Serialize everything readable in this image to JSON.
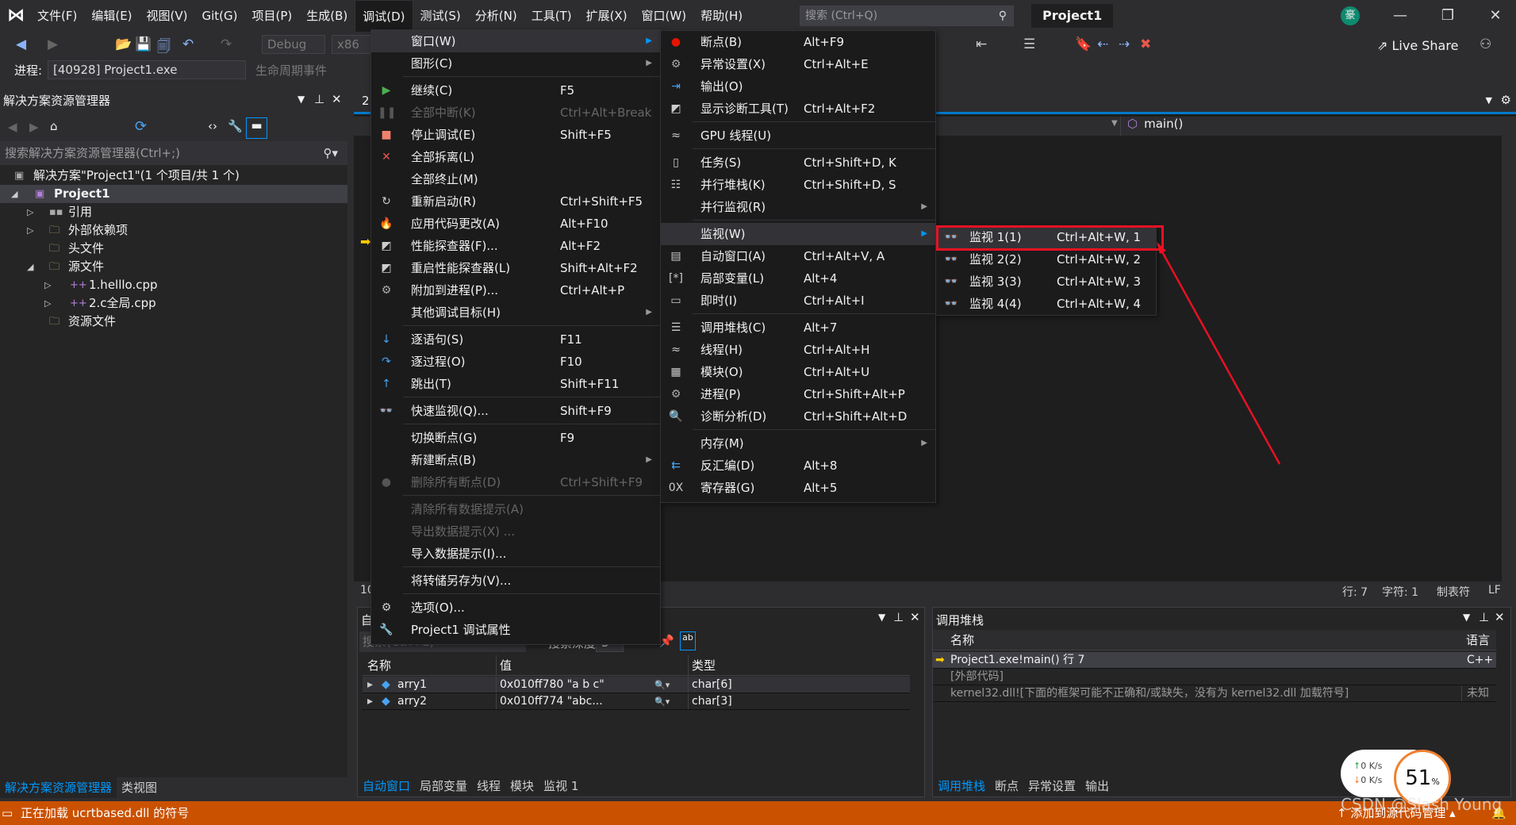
{
  "menubar": {
    "items": [
      "文件(F)",
      "编辑(E)",
      "视图(V)",
      "Git(G)",
      "项目(P)",
      "生成(B)",
      "调试(D)",
      "测试(S)",
      "分析(N)",
      "工具(T)",
      "扩展(X)",
      "窗口(W)",
      "帮助(H)"
    ],
    "active_index": 6,
    "search_placeholder": "搜索 (Ctrl+Q)",
    "project_title": "Project1",
    "avatar": "豪"
  },
  "toolbar": {
    "config": "Debug",
    "platform": "x86",
    "process_label": "进程:",
    "process_value": "[40928] Project1.exe",
    "lifecycle": "生命周期事件",
    "live_share": "Live Share"
  },
  "solution_explorer": {
    "title": "解决方案资源管理器",
    "search_placeholder": "搜索解决方案资源管理器(Ctrl+;)",
    "tree": [
      {
        "label": "解决方案\"Project1\"(1 个项目/共 1 个)",
        "level": 0,
        "twisty": "",
        "icon": "solution-icon"
      },
      {
        "label": "Project1",
        "level": 1,
        "twisty": "expanded",
        "icon": "cpp-project-icon",
        "bold": true,
        "selected": true
      },
      {
        "label": "引用",
        "level": 2,
        "twisty": "collapsed",
        "icon": "references-icon"
      },
      {
        "label": "外部依赖项",
        "level": 2,
        "twisty": "collapsed",
        "icon": "external-deps-icon"
      },
      {
        "label": "头文件",
        "level": 2,
        "twisty": "",
        "icon": "filter-folder-icon"
      },
      {
        "label": "源文件",
        "level": 2,
        "twisty": "expanded",
        "icon": "filter-folder-icon"
      },
      {
        "label": "1.helllo.cpp",
        "level": 3,
        "twisty": "collapsed",
        "icon": "cpp-file-icon"
      },
      {
        "label": "2.c全局.cpp",
        "level": 3,
        "twisty": "collapsed",
        "icon": "cpp-file-icon"
      },
      {
        "label": "资源文件",
        "level": 2,
        "twisty": "",
        "icon": "filter-folder-icon"
      }
    ],
    "tabs": [
      "解决方案资源管理器",
      "类视图"
    ]
  },
  "editor": {
    "tab_fragment": "2.",
    "nav_function": "main()",
    "zoom_fragment": "10",
    "status": {
      "line": "行: 7",
      "char": "字符: 1",
      "tabs": "制表符",
      "eol": "LF"
    }
  },
  "debug_menu": [
    {
      "label": "窗口(W)",
      "submenu": true,
      "highlight": true
    },
    {
      "label": "图形(C)",
      "submenu": true
    },
    {
      "sep": true
    },
    {
      "label": "继续(C)",
      "shortcut": "F5",
      "icon": "▶",
      "color": "#4caf50"
    },
    {
      "label": "全部中断(K)",
      "shortcut": "Ctrl+Alt+Break",
      "icon": "❚❚",
      "disabled": true
    },
    {
      "label": "停止调试(E)",
      "shortcut": "Shift+F5",
      "icon": "■",
      "color": "#f0806c"
    },
    {
      "label": "全部拆离(L)",
      "icon": "✕",
      "color": "#e8584a"
    },
    {
      "label": "全部终止(M)"
    },
    {
      "label": "重新启动(R)",
      "shortcut": "Ctrl+Shift+F5",
      "icon": "↻",
      "color": "#ccc"
    },
    {
      "label": "应用代码更改(A)",
      "shortcut": "Alt+F10",
      "icon": "🔥",
      "color": "#e53935"
    },
    {
      "label": "性能探查器(F)...",
      "shortcut": "Alt+F2",
      "icon": "◩",
      "color": "#ccc"
    },
    {
      "label": "重启性能探查器(L)",
      "shortcut": "Shift+Alt+F2",
      "icon": "◩",
      "color": "#ccc"
    },
    {
      "label": "附加到进程(P)...",
      "shortcut": "Ctrl+Alt+P",
      "icon": "⚙",
      "color": "#aaa"
    },
    {
      "label": "其他调试目标(H)",
      "submenu": true
    },
    {
      "sep": true
    },
    {
      "label": "逐语句(S)",
      "shortcut": "F11",
      "icon": "↓",
      "color": "#4aa3f0"
    },
    {
      "label": "逐过程(O)",
      "shortcut": "F10",
      "icon": "↷",
      "color": "#4aa3f0"
    },
    {
      "label": "跳出(T)",
      "shortcut": "Shift+F11",
      "icon": "↑",
      "color": "#4aa3f0"
    },
    {
      "sep": true
    },
    {
      "label": "快速监视(Q)...",
      "shortcut": "Shift+F9",
      "icon": "👓",
      "color": "#ccc"
    },
    {
      "sep": true
    },
    {
      "label": "切换断点(G)",
      "shortcut": "F9"
    },
    {
      "label": "新建断点(B)",
      "submenu": true
    },
    {
      "label": "删除所有断点(D)",
      "shortcut": "Ctrl+Shift+F9",
      "icon": "●",
      "disabled": true
    },
    {
      "sep": true
    },
    {
      "label": "清除所有数据提示(A)",
      "disabled": true
    },
    {
      "label": "导出数据提示(X) ...",
      "disabled": true
    },
    {
      "label": "导入数据提示(I)..."
    },
    {
      "sep": true
    },
    {
      "label": "将转储另存为(V)..."
    },
    {
      "sep": true
    },
    {
      "label": "选项(O)...",
      "icon": "⚙",
      "color": "#ccc"
    },
    {
      "label": "Project1 调试属性",
      "icon": "🔧",
      "color": "#ccc"
    }
  ],
  "window_submenu": [
    {
      "label": "断点(B)",
      "shortcut": "Alt+F9",
      "icon": "●",
      "color": "#e51400"
    },
    {
      "label": "异常设置(X)",
      "shortcut": "Ctrl+Alt+E",
      "icon": "⚙",
      "color": "#aaa"
    },
    {
      "label": "输出(O)",
      "icon": "⇥",
      "color": "#4aa3f0"
    },
    {
      "label": "显示诊断工具(T)",
      "shortcut": "Ctrl+Alt+F2",
      "icon": "◩",
      "color": "#ccc"
    },
    {
      "sep": true
    },
    {
      "label": "GPU 线程(U)",
      "icon": "≈",
      "color": "#ccc"
    },
    {
      "sep": true
    },
    {
      "label": "任务(S)",
      "shortcut": "Ctrl+Shift+D, K",
      "icon": "▯",
      "color": "#ccc"
    },
    {
      "label": "并行堆栈(K)",
      "shortcut": "Ctrl+Shift+D, S",
      "icon": "☷",
      "color": "#ccc"
    },
    {
      "label": "并行监视(R)",
      "submenu": true
    },
    {
      "sep": true
    },
    {
      "label": "监视(W)",
      "submenu": true,
      "highlight": true
    },
    {
      "label": "自动窗口(A)",
      "shortcut": "Ctrl+Alt+V, A",
      "icon": "▤",
      "color": "#ccc"
    },
    {
      "label": "局部变量(L)",
      "shortcut": "Alt+4",
      "icon": "[*]",
      "color": "#ccc"
    },
    {
      "label": "即时(I)",
      "shortcut": "Ctrl+Alt+I",
      "icon": "▭",
      "color": "#ccc"
    },
    {
      "sep": true
    },
    {
      "label": "调用堆栈(C)",
      "shortcut": "Alt+7",
      "icon": "☰",
      "color": "#ccc"
    },
    {
      "label": "线程(H)",
      "shortcut": "Ctrl+Alt+H",
      "icon": "≈",
      "color": "#ccc"
    },
    {
      "label": "模块(O)",
      "shortcut": "Ctrl+Alt+U",
      "icon": "▦",
      "color": "#ccc"
    },
    {
      "label": "进程(P)",
      "shortcut": "Ctrl+Shift+Alt+P",
      "icon": "⚙",
      "color": "#aaa"
    },
    {
      "label": "诊断分析(D)",
      "shortcut": "Ctrl+Shift+Alt+D",
      "icon": "🔍",
      "color": "#4aa3f0"
    },
    {
      "sep": true
    },
    {
      "label": "内存(M)",
      "submenu": true
    },
    {
      "label": "反汇编(D)",
      "shortcut": "Alt+8",
      "icon": "⇇",
      "color": "#4aa3f0"
    },
    {
      "label": "寄存器(G)",
      "shortcut": "Alt+5",
      "icon": "0X",
      "color": "#ccc"
    }
  ],
  "watch_submenu": [
    {
      "label": "监视 1(1)",
      "shortcut": "Ctrl+Alt+W, 1",
      "icon": "👓",
      "color": "#ccc",
      "highlight": true
    },
    {
      "label": "监视 2(2)",
      "shortcut": "Ctrl+Alt+W, 2",
      "icon": "👓",
      "color": "#ccc"
    },
    {
      "label": "监视 3(3)",
      "shortcut": "Ctrl+Alt+W, 3",
      "icon": "👓",
      "color": "#ccc"
    },
    {
      "label": "监视 4(4)",
      "shortcut": "Ctrl+Alt+W, 4",
      "icon": "👓",
      "color": "#ccc"
    }
  ],
  "autos": {
    "title_fragment": "自",
    "search_placeholder": "搜索(Ctrl+E)",
    "depth_label": "搜索深度:",
    "depth_value": "3",
    "columns": [
      "名称",
      "值",
      "类型"
    ],
    "rows": [
      {
        "name": "arry1",
        "value": "0x010ff780 \"a b c\"",
        "type": "char[6]"
      },
      {
        "name": "arry2",
        "value": "0x010ff774 \"abc...",
        "type": "char[3]"
      }
    ],
    "tabs": [
      "自动窗口",
      "局部变量",
      "线程",
      "模块",
      "监视 1"
    ]
  },
  "callstack": {
    "title": "调用堆栈",
    "columns": [
      "名称",
      "语言"
    ],
    "rows": [
      {
        "name": "Project1.exe!main() 行 7",
        "lang": "C++",
        "current": true
      },
      {
        "name": "[外部代码]",
        "lang": ""
      },
      {
        "name": "kernel32.dll![下面的框架可能不正确和/或缺失，没有为 kernel32.dll 加载符号]",
        "lang": "未知"
      }
    ],
    "tabs": [
      "调用堆栈",
      "断点",
      "异常设置",
      "输出"
    ]
  },
  "status": {
    "message": "正在加载 ucrtbased.dll 的符号",
    "source_control": "添加到源代码管理"
  },
  "overlay": {
    "up_speed": "0",
    "down_speed": "0",
    "speed_unit": "K/s",
    "cpu_percent": "51",
    "percent_sign": "%",
    "watermark": "CSDN @Slash   Young"
  },
  "colors": {
    "accent": "#007acc",
    "status_bar": "#ca5100",
    "annotation": "#e81123"
  }
}
